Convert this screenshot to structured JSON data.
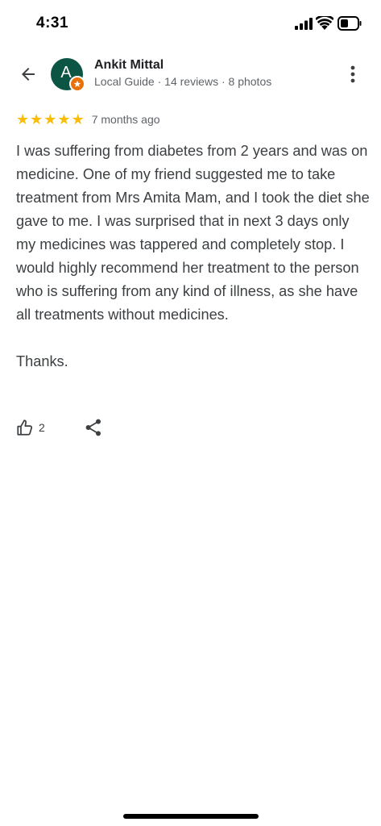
{
  "status_bar": {
    "time": "4:31",
    "icons": [
      "signal-icon",
      "wifi-icon",
      "battery-icon"
    ]
  },
  "header": {
    "back_icon": "arrow-left-icon",
    "avatar_letter": "A",
    "avatar_color": "#0c5544",
    "badge_color": "#e8710a",
    "reviewer_name": "Ankit Mittal",
    "reviewer_meta": "Local Guide · 14 reviews · 8 photos",
    "more_icon": "more-vertical-icon"
  },
  "review": {
    "rating": 5,
    "star_color": "#fbbc04",
    "stars": [
      "★",
      "★",
      "★",
      "★",
      "★"
    ],
    "time_ago": "7 months ago",
    "text": "I was suffering from diabetes from 2 years and was on medicine. One of my friend suggested me to take treatment from Mrs Amita Mam, and I took the diet she gave to me. I was surprised that in next 3 days only my medicines was tappered and completely stop. I would highly recommend her treatment to the person who is suffering from any kind of illness, as she have all treatments without medicines.\n\nThanks."
  },
  "actions": {
    "like_icon": "thumbs-up-icon",
    "like_count": "2",
    "share_icon": "share-icon"
  }
}
